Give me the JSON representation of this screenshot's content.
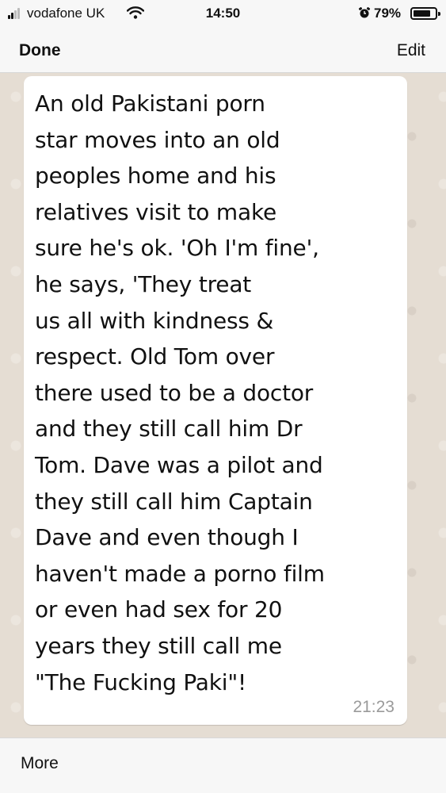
{
  "status_bar": {
    "carrier": "vodafone UK",
    "time": "14:50",
    "battery": "79%",
    "battery_level": 0.79,
    "icons": [
      "signal-icon",
      "wifi-icon",
      "alarm-icon",
      "battery-icon"
    ]
  },
  "nav": {
    "done_label": "Done",
    "edit_label": "Edit"
  },
  "message": {
    "lines": [
      "An old Pakistani porn",
      "star moves into an old",
      "peoples home and his",
      "relatives visit to make",
      "sure he's ok. 'Oh I'm fine',",
      "he says, 'They treat",
      "us all with kindness &",
      "respect. Old Tom over",
      "there used to be a doctor",
      "and they still call him Dr",
      "Tom. Dave was a pilot and",
      "they still call him Captain",
      "Dave and even though I",
      "haven't made a porno film",
      "or even had sex for 20",
      "years they still call me",
      "\"The Fucking Paki\"!"
    ],
    "timestamp": "21:23"
  },
  "bottom_bar": {
    "more_label": "More"
  },
  "colors": {
    "chat_background": "#e5ddd3",
    "bubble": "#ffffff",
    "bars": "#f7f7f7",
    "timestamp": "#9a9a9a"
  }
}
